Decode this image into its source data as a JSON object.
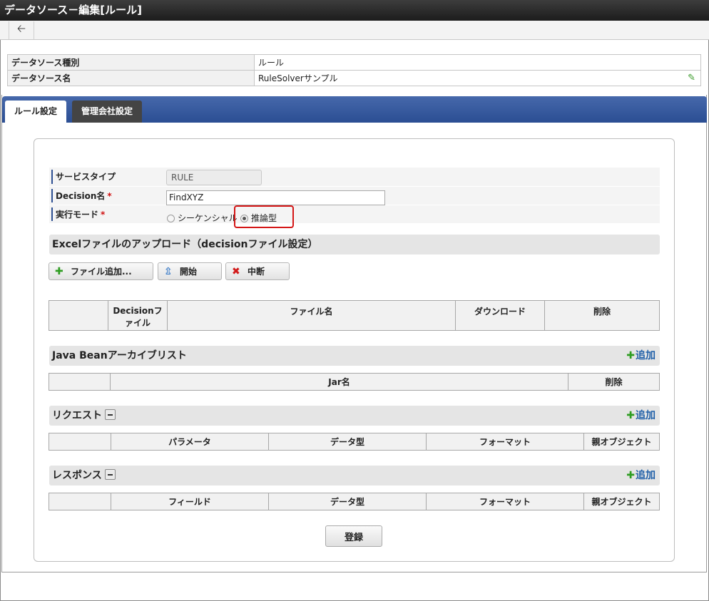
{
  "window": {
    "title": "データソース－編集[ルール]"
  },
  "info": [
    {
      "label": "データソース種別",
      "value": "ルール"
    },
    {
      "label": "データソース名",
      "value": "RuleSolverサンプル"
    }
  ],
  "tabs": [
    {
      "label": "ルール設定",
      "active": true
    },
    {
      "label": "管理会社設定",
      "active": false
    }
  ],
  "form": {
    "service_type_label": "サービスタイプ",
    "service_type_value": "RULE",
    "decision_label": "Decision名",
    "decision_value": "FindXYZ",
    "mode_label": "実行モード",
    "required_mark": "*",
    "mode_options": [
      {
        "label": "シーケンシャル",
        "selected": false
      },
      {
        "label": "推論型",
        "selected": true
      }
    ]
  },
  "excel": {
    "title": "Excelファイルのアップロード（decisionファイル設定）",
    "buttons": {
      "add": "ファイル追加...",
      "start": "開始",
      "stop": "中断"
    },
    "columns": [
      "",
      "Decisionファイル",
      "ファイル名",
      "ダウンロード",
      "削除"
    ]
  },
  "jar": {
    "title": "Java Beanアーカイブリスト",
    "add_label": "追加",
    "columns": [
      "",
      "Jar名",
      "削除"
    ]
  },
  "request": {
    "title": "リクエスト",
    "add_label": "追加",
    "columns": [
      "",
      "パラメータ",
      "データ型",
      "フォーマット",
      "親オブジェクト"
    ]
  },
  "response": {
    "title": "レスポンス",
    "add_label": "追加",
    "columns": [
      "",
      "フィールド",
      "データ型",
      "フォーマット",
      "親オブジェクト"
    ]
  },
  "register_label": "登録",
  "colors": {
    "accent": "#2b4e93",
    "highlight": "#d41616",
    "add_icon": "#2f9d22",
    "link": "#1f5fa8"
  }
}
